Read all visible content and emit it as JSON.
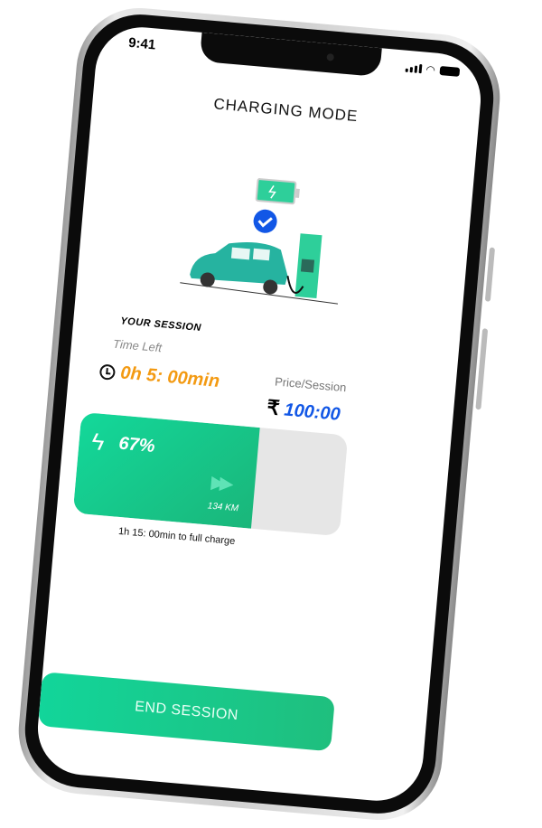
{
  "status_bar": {
    "time": "9:41"
  },
  "header": {
    "title": "CHARGING MODE"
  },
  "session": {
    "heading": "YOUR SESSION",
    "time_left_label": "Time Left",
    "time_left": "0h 5: 00min",
    "price_label": "Price/Session",
    "currency": "₹",
    "price": "100:00"
  },
  "battery": {
    "percent_label": "67%",
    "percent": 67,
    "range": "134 KM",
    "full_charge_text": "1h 15: 00min  to full charge"
  },
  "actions": {
    "end_session": "END SESSION"
  },
  "colors": {
    "accent": "#13d89a",
    "time": "#f39a12",
    "price": "#1257e6",
    "check": "#1257e6"
  },
  "icons": [
    "clock-icon",
    "bolt-icon",
    "fast-forward-icon",
    "check-icon",
    "battery-icon",
    "wifi-icon",
    "signal-icon"
  ]
}
